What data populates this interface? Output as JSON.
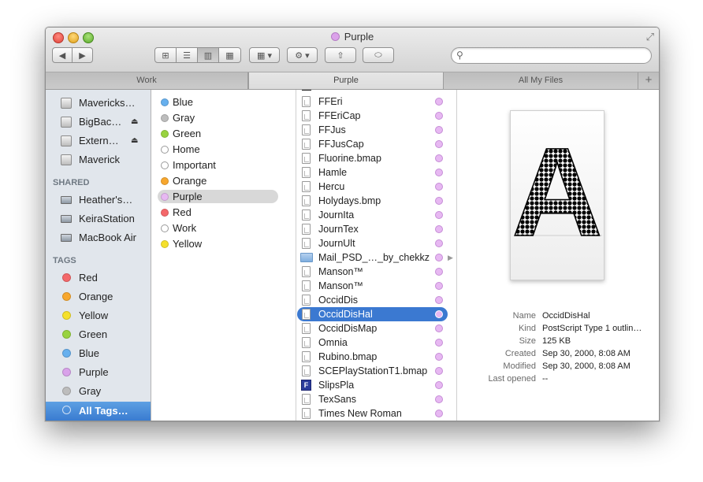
{
  "window": {
    "title": "Purple",
    "title_tag_color": "#dba2ea"
  },
  "toolbar": {
    "back": "◀",
    "forward": "▶",
    "view_icon": "⊞",
    "list_icon": "☰",
    "column_icon": "▥",
    "coverflow_icon": "▦",
    "arrange_icon": "▦ ▾",
    "action_icon": "⚙ ▾",
    "share_icon": "⇧",
    "tag_icon": "⬭",
    "search_icon": "⚲",
    "search_value": "",
    "search_placeholder": ""
  },
  "tabs": [
    {
      "label": "Work"
    },
    {
      "label": "Purple"
    },
    {
      "label": "All My Files"
    }
  ],
  "tab_add": "+",
  "sidebar": {
    "devices": [
      {
        "label": "Mavericks…",
        "eject": ""
      },
      {
        "label": "BigBac…",
        "eject": "⏏"
      },
      {
        "label": "Extern…",
        "eject": "⏏"
      },
      {
        "label": "Maverick",
        "eject": ""
      }
    ],
    "shared_header": "SHARED",
    "shared": [
      {
        "label": "Heather's…"
      },
      {
        "label": "KeiraStation"
      },
      {
        "label": "MacBook Air"
      }
    ],
    "tags_header": "TAGS",
    "tags": [
      {
        "label": "Red",
        "color": "#f4686a"
      },
      {
        "label": "Orange",
        "color": "#f7a72e"
      },
      {
        "label": "Yellow",
        "color": "#f5e02b"
      },
      {
        "label": "Green",
        "color": "#98d33f"
      },
      {
        "label": "Blue",
        "color": "#67b0ee"
      },
      {
        "label": "Purple",
        "color": "#d9a2ea"
      },
      {
        "label": "Gray",
        "color": "#bdbdbd"
      }
    ],
    "all_tags": "All Tags…"
  },
  "tag_column": [
    {
      "label": "Blue",
      "color": "#67b0ee"
    },
    {
      "label": "Gray",
      "color": "#bdbdbd"
    },
    {
      "label": "Green",
      "color": "#98d33f"
    },
    {
      "label": "Home",
      "color": ""
    },
    {
      "label": "Important",
      "color": ""
    },
    {
      "label": "Orange",
      "color": "#f7a72e"
    },
    {
      "label": "Purple",
      "color": "#e7b8f2"
    },
    {
      "label": "Red",
      "color": "#f4686a"
    },
    {
      "label": "Work",
      "color": ""
    },
    {
      "label": "Yellow",
      "color": "#f5e02b"
    }
  ],
  "files": [
    {
      "name": "FFEri",
      "kind": "doc"
    },
    {
      "name": "FFEriCap",
      "kind": "doc"
    },
    {
      "name": "FFJus",
      "kind": "doc"
    },
    {
      "name": "FFJusCap",
      "kind": "doc"
    },
    {
      "name": "Fluorine.bmap",
      "kind": "doc"
    },
    {
      "name": "Hamle",
      "kind": "doc"
    },
    {
      "name": "Hercu",
      "kind": "doc"
    },
    {
      "name": "Holydays.bmp",
      "kind": "doc"
    },
    {
      "name": "JournIta",
      "kind": "doc"
    },
    {
      "name": "JournTex",
      "kind": "doc"
    },
    {
      "name": "JournUlt",
      "kind": "doc"
    },
    {
      "name": "Mail_PSD_…_by_chekkz",
      "kind": "folder"
    },
    {
      "name": "Manson™",
      "kind": "doc"
    },
    {
      "name": "Manson™",
      "kind": "doc"
    },
    {
      "name": "OccidDis",
      "kind": "doc"
    },
    {
      "name": "OccidDisHal",
      "kind": "doc"
    },
    {
      "name": "OccidDisMap",
      "kind": "doc"
    },
    {
      "name": "Omnia",
      "kind": "doc"
    },
    {
      "name": "Rubino.bmap",
      "kind": "doc"
    },
    {
      "name": "SCEPlayStationT1.bmap",
      "kind": "doc"
    },
    {
      "name": "SlipsPla",
      "kind": "app"
    },
    {
      "name": "TexSans",
      "kind": "doc"
    },
    {
      "name": "Times New Roman",
      "kind": "doc"
    }
  ],
  "folder_arrow": "▶",
  "preview": {
    "glyph": "A",
    "meta": [
      {
        "key": "Name",
        "value": "OccidDisHal"
      },
      {
        "key": "Kind",
        "value": "PostScript Type 1 outlin…"
      },
      {
        "key": "Size",
        "value": "125 KB"
      },
      {
        "key": "Created",
        "value": "Sep 30, 2000, 8:08 AM"
      },
      {
        "key": "Modified",
        "value": "Sep 30, 2000, 8:08 AM"
      },
      {
        "key": "Last opened",
        "value": "--"
      }
    ]
  }
}
